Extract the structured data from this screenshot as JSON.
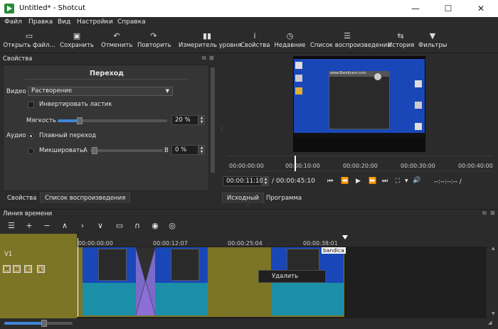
{
  "window": {
    "title": "Untitled* - Shotcut",
    "min_glyph": "—",
    "max_glyph": "☐",
    "close_glyph": "✕"
  },
  "menu": [
    "Файл",
    "Правка",
    "Вид",
    "Настройки",
    "Справка"
  ],
  "toolbar": [
    {
      "label": "Открыть файл...",
      "icon": "folder-open-icon",
      "glyph": "▭"
    },
    {
      "label": "Сохранить",
      "icon": "save-icon",
      "glyph": "▣"
    },
    {
      "label": "Отменить",
      "icon": "undo-icon",
      "glyph": "↶"
    },
    {
      "label": "Повторить",
      "icon": "redo-icon",
      "glyph": "↷"
    },
    {
      "label": "Измеритель уровня",
      "icon": "level-meter-icon",
      "glyph": "▮▮"
    },
    {
      "label": "Свойства",
      "icon": "info-icon",
      "glyph": "i"
    },
    {
      "label": "Недавние",
      "icon": "clock-icon",
      "glyph": "◷"
    },
    {
      "label": "Список воспроизведения",
      "icon": "playlist-icon",
      "glyph": "☰"
    },
    {
      "label": "История",
      "icon": "history-icon",
      "glyph": "⇆"
    },
    {
      "label": "Фильтры",
      "icon": "filter-icon",
      "glyph": "▼"
    }
  ],
  "properties": {
    "header": "Свойства",
    "title": "Переход",
    "video_label": "Видео",
    "video_value": "Растворение",
    "invert_label": "Инвертировать ластик",
    "softness_label": "Мягкость",
    "softness_value": "20 %",
    "softness_fraction": 0.2,
    "audio_label": "Аудио",
    "crossfade_label": "Плавный переход",
    "mix_label": "Микшировать:",
    "mix_a": "A",
    "mix_b": "B",
    "mix_value": "0 %",
    "mix_fraction": 0.0
  },
  "left_tabs": [
    "Свойства",
    "Список воспроизведения"
  ],
  "preview": {
    "ruler_ticks": [
      "00:00:00:00",
      "00:00:10:00",
      "00:00:20:00",
      "00:00:30:00",
      "00:00:40:00"
    ],
    "current_time": "00:00:11:10",
    "total_time": "/ 00:00:45:10",
    "timecode_placeholder": "--:--:--:-- /",
    "tabs": [
      "Исходный",
      "Программа"
    ],
    "video_caption": "www.Bandicam.com"
  },
  "transport": [
    "⏮",
    "⏪",
    "▶",
    "⏩",
    "⏭",
    "⛶",
    "🔊"
  ],
  "timeline": {
    "header": "Линия времени",
    "track_name": "V1",
    "track_buttons": [
      "M",
      "H",
      "C",
      "L"
    ],
    "ruler_ticks": [
      "00:00:00:00",
      "00:00:12:07",
      "00:00:25:04",
      "00:00:38:01"
    ],
    "clip_label": "bandica",
    "context_menu_item": "Удалить"
  },
  "tl_tools": [
    "☰",
    "+",
    "−",
    "∧",
    "›",
    "∨",
    "▭",
    "∩",
    "◉",
    "◎"
  ],
  "colors": {
    "accent": "#3f86d6",
    "track": "#7d7526",
    "thumb": "#1a47b8",
    "wave": "#1b8fa8",
    "transition": "#8b6fd6"
  }
}
